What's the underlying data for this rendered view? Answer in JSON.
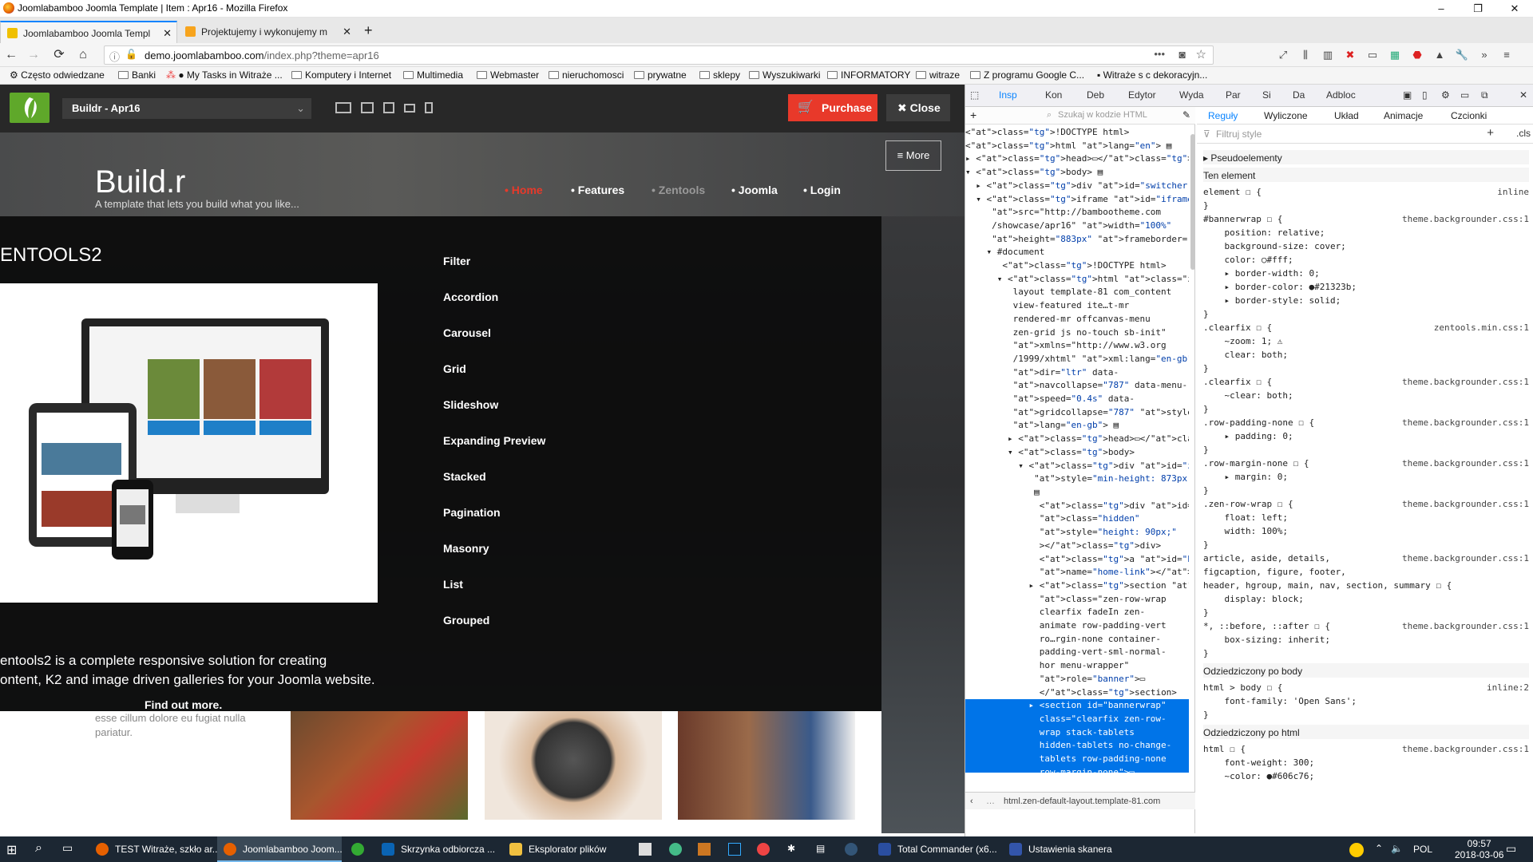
{
  "window": {
    "title": "Joomlabamboo Joomla Template | Item : Apr16 - Mozilla Firefox",
    "min": "–",
    "max": "❐",
    "close": "✕"
  },
  "tabs": [
    {
      "label": "Joomlabamboo Joomla Templ",
      "close": "✕"
    },
    {
      "label": "Projektujemy i wykonujemy m",
      "close": "✕"
    }
  ],
  "newtab": "+",
  "nav": {
    "back": "←",
    "forward": "→",
    "reload": "⟳",
    "home": "⌂",
    "url_host": "demo.joomlabamboo.com",
    "url_path": "/index.php?theme=apr16",
    "more": "•••"
  },
  "bookmarks": [
    "Często odwiedzane",
    "Banki",
    "● My Tasks in Witraże ...",
    "Komputery i Internet",
    "Multimedia",
    "Webmaster",
    "nieruchomosci",
    "prywatne",
    "sklepy",
    "Wyszukiwarki",
    "INFORMATORY",
    "witraze",
    "Z programu Google C...",
    "Witraże s c dekoracyjn..."
  ],
  "switcher": {
    "theme": "Buildr - Apr16",
    "purchase": "Purchase",
    "close": "Close"
  },
  "site": {
    "brand": "Build.r",
    "tagline": "A template that lets you build what you like...",
    "menu": [
      "• Home",
      "• Features",
      "• Zentools",
      "• Joomla",
      "• Login"
    ],
    "more": "≡ More",
    "dropdown_title": "ENTOOLS2",
    "dropdown_links": [
      "Filter",
      "Accordion",
      "Carousel",
      "Grid",
      "Slideshow",
      "Expanding Preview",
      "Stacked",
      "Pagination",
      "Masonry",
      "List",
      "Grouped"
    ],
    "desc_line1": "entools2 is a complete responsive solution for creating",
    "desc_line2": "ontent, K2 and image driven galleries for your Joomla website.",
    "find_more": "Find out more.",
    "below_text": "esse cillum dolore eu fugiat nulla pariatur."
  },
  "devtools": {
    "tabs": [
      "Insp",
      "Kon",
      "Deb",
      "Edytor",
      "Wyda",
      "Par",
      "Si",
      "Da",
      "Adbloc"
    ],
    "search_placeholder": "Szukaj w kodzie HTML",
    "rule_tabs": [
      "Reguły",
      "Wyliczone",
      "Układ",
      "Animacje",
      "Czcionki"
    ],
    "filter_placeholder": "Filtruj style",
    "cls": ".cls",
    "pseudo": "Pseudoelementy",
    "this_element": "Ten element",
    "inherited_body": "Odziedziczony po body",
    "inherited_html": "Odziedziczony po html",
    "breadcrumb": "html.zen-default-layout.template-81.com",
    "tree": [
      "<!DOCTYPE html>",
      "<html lang=\"en\"> ▤",
      "▸ <head>▭</head>",
      "▾ <body> ▤",
      "  ▸ <div id=\"switcher\">▭</div>",
      "  ▾ <iframe id=\"iframe\"",
      "     src=\"http://bambootheme.com",
      "     /showcase/apr16\" width=\"100%\"",
      "     height=\"883px\" frameborder=\"0\">",
      "    ▾ #document",
      "       <!DOCTYPE html>",
      "      ▾ <html class=\"zen-default-",
      "         layout template-81 com_content",
      "         view-featured ite…t-mr",
      "         rendered-mr offcanvas-menu",
      "         zen-grid js no-touch sb-init\"",
      "         xmlns=\"http://www.w3.org",
      "         /1999/xhtml\" xml:lang=\"en-gb\"",
      "         dir=\"ltr\" data-",
      "         navcollapse=\"787\" data-menu-",
      "         speed=\"0.4s\" data-",
      "         gridcollapse=\"787\" style=\"\"",
      "         lang=\"en-gb\"> ▤",
      "        ▸ <head>▭</head>",
      "        ▾ <body>",
      "          ▾ <div id=\"zen-wrap\"",
      "             style=\"min-height: 873px;\">",
      "             ▤",
      "              <div id=\"sticky-fill\"",
      "              class=\"hidden\"",
      "              style=\"height: 90px;\"",
      "              ></div>",
      "              <a id=\"home-link\"",
      "              name=\"home-link\"></a> ▤",
      "            ▸ <section id=\"logowrap\"",
      "              class=\"zen-row-wrap",
      "              clearfix fadeIn zen-",
      "              animate row-padding-vert",
      "              ro…rgin-none container-",
      "              padding-vert-sml-normal-",
      "              hor menu-wrapper\"",
      "              role=\"banner\">▭",
      "              </section>"
    ],
    "tree_selected": [
      "            ▸ <section id=\"bannerwrap\"",
      "              class=\"clearfix zen-row-",
      "              wrap stack-tablets",
      "              hidden-tablets no-change-",
      "              tablets row-padding-none",
      "              row-margin-none\">▭",
      "              </section>"
    ],
    "rules": [
      {
        "sel": "element ☐ {",
        "src": "inline",
        "props": []
      },
      {
        "sel": "#bannerwrap ☐ {",
        "src": "theme.backgrounder.css:1",
        "props": [
          "position: relative;",
          "background-size: cover;",
          "color: ○#fff;",
          "▸ border-width: 0;",
          "▸ border-color: ●#21323b;",
          "▸ border-style: solid;"
        ]
      },
      {
        "sel": ".clearfix ☐ {",
        "src": "zentools.min.css:1",
        "props": [
          "~zoom: 1; ⚠",
          "clear: both;"
        ]
      },
      {
        "sel": ".clearfix ☐ {",
        "src": "theme.backgrounder.css:1",
        "props": [
          "~clear: both;"
        ]
      },
      {
        "sel": ".row-padding-none ☐ {",
        "src": "theme.backgrounder.css:1",
        "props": [
          "▸ padding: 0;"
        ]
      },
      {
        "sel": ".row-margin-none ☐ {",
        "src": "theme.backgrounder.css:1",
        "props": [
          "▸ margin: 0;"
        ]
      },
      {
        "sel": ".zen-row-wrap ☐ {",
        "src": "theme.backgrounder.css:1",
        "props": [
          "float: left;",
          "width: 100%;"
        ]
      }
    ],
    "rule_multi": [
      "article, aside, details,",
      "figcaption, figure, footer,",
      "header, hgroup, main, nav, section, summary ☐ {"
    ],
    "rule_multi_src": "theme.backgrounder.css:1",
    "rule_multi_prop": "display: block;",
    "rule_star": "*, ::before, ::after ☐ {",
    "rule_star_prop": "box-sizing: inherit;",
    "rule_body": "html > body ☐ {",
    "rule_body_src": "inline:2",
    "rule_body_prop": "font-family: 'Open Sans';",
    "rule_html": "html ☐ {",
    "rule_html_props": [
      "font-weight: 300;",
      "~color: ●#606c76;"
    ]
  },
  "taskbar": {
    "items": [
      "TEST Witraże, szkło ar...",
      "Joomlabamboo Joom...",
      "Skrzynka odbiorcza ...",
      "Eksplorator plików",
      "Total Commander (x6...",
      "Ustawienia skanera"
    ],
    "lang": "POL",
    "time": "09:57",
    "date": "2018-03-06"
  }
}
